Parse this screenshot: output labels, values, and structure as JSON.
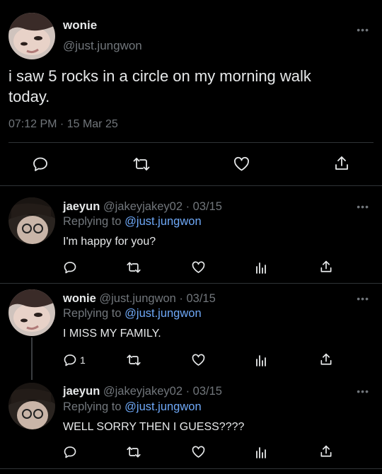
{
  "main_tweet": {
    "display_name": "wonie",
    "handle": "@just.jungwon",
    "text": "i saw 5 rocks in a circle on my morning walk today.",
    "timestamp": "07:12 PM · 15 Mar 25",
    "more_label": "•••"
  },
  "replies": [
    {
      "display_name": "jaeyun",
      "handle_date": "@jakeyjakey02 · 03/15",
      "replying_prefix": "Replying to",
      "replying_to": "@just.jungwon",
      "text": "I'm happy for you?",
      "reply_count": "",
      "more_label": "•••"
    },
    {
      "display_name": "wonie",
      "handle_date": "@just.jungwon · 03/15",
      "replying_prefix": "Replying to",
      "replying_to": "@just.jungwon",
      "text": "I MISS MY FAMILY.",
      "reply_count": "1",
      "more_label": "•••"
    },
    {
      "display_name": "jaeyun",
      "handle_date": "@jakeyjakey02 · 03/15",
      "replying_prefix": "Replying to",
      "replying_to": "@just.jungwon",
      "text": "WELL SORRY THEN I GUESS????",
      "reply_count": "",
      "more_label": "•••"
    }
  ],
  "colors": {
    "background": "#000000",
    "text": "#e7e9ea",
    "muted": "#71767b",
    "link": "#6ea8f7",
    "divider": "#2f3336"
  }
}
